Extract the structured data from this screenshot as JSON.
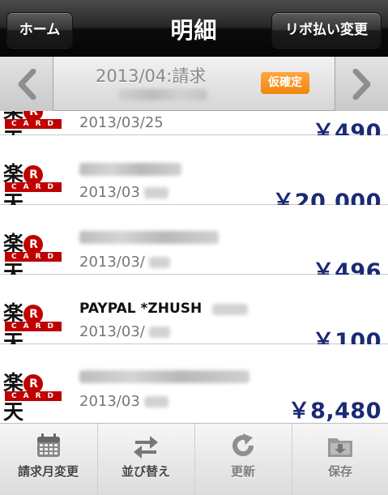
{
  "navbar": {
    "title": "明細",
    "home_label": "ホーム",
    "revolving_label": "リボ払い変更"
  },
  "period": {
    "label": "2013/04:請求",
    "badge": "仮確定",
    "prev_icon": "chevron-left-icon",
    "next_icon": "chevron-right-icon"
  },
  "transactions": [
    {
      "brand": "楽天",
      "card": "CARD",
      "merchant": "",
      "date": "2013/03/25",
      "amount": "￥490"
    },
    {
      "brand": "楽天",
      "card": "CARD",
      "merchant": "",
      "date": "2013/03",
      "amount": "￥20,000"
    },
    {
      "brand": "楽天",
      "card": "CARD",
      "merchant": "",
      "date": "2013/03/",
      "amount": "￥496"
    },
    {
      "brand": "楽天",
      "card": "CARD",
      "merchant": "PAYPAL *ZHUSH",
      "date": "2013/03/",
      "amount": "￥100"
    },
    {
      "brand": "楽天",
      "card": "CARD",
      "merchant": "",
      "date": "2013/03",
      "amount": "￥8,480"
    }
  ],
  "toolbar": {
    "items": [
      {
        "label": "請求月変更",
        "icon": "calendar-icon"
      },
      {
        "label": "並び替え",
        "icon": "swap-arrows-icon"
      },
      {
        "label": "更新",
        "icon": "refresh-icon"
      },
      {
        "label": "保存",
        "icon": "save-folder-icon"
      }
    ]
  },
  "colors": {
    "amount": "#1b2a74",
    "badge": "#f0860e",
    "brand_red": "#bf0000"
  }
}
